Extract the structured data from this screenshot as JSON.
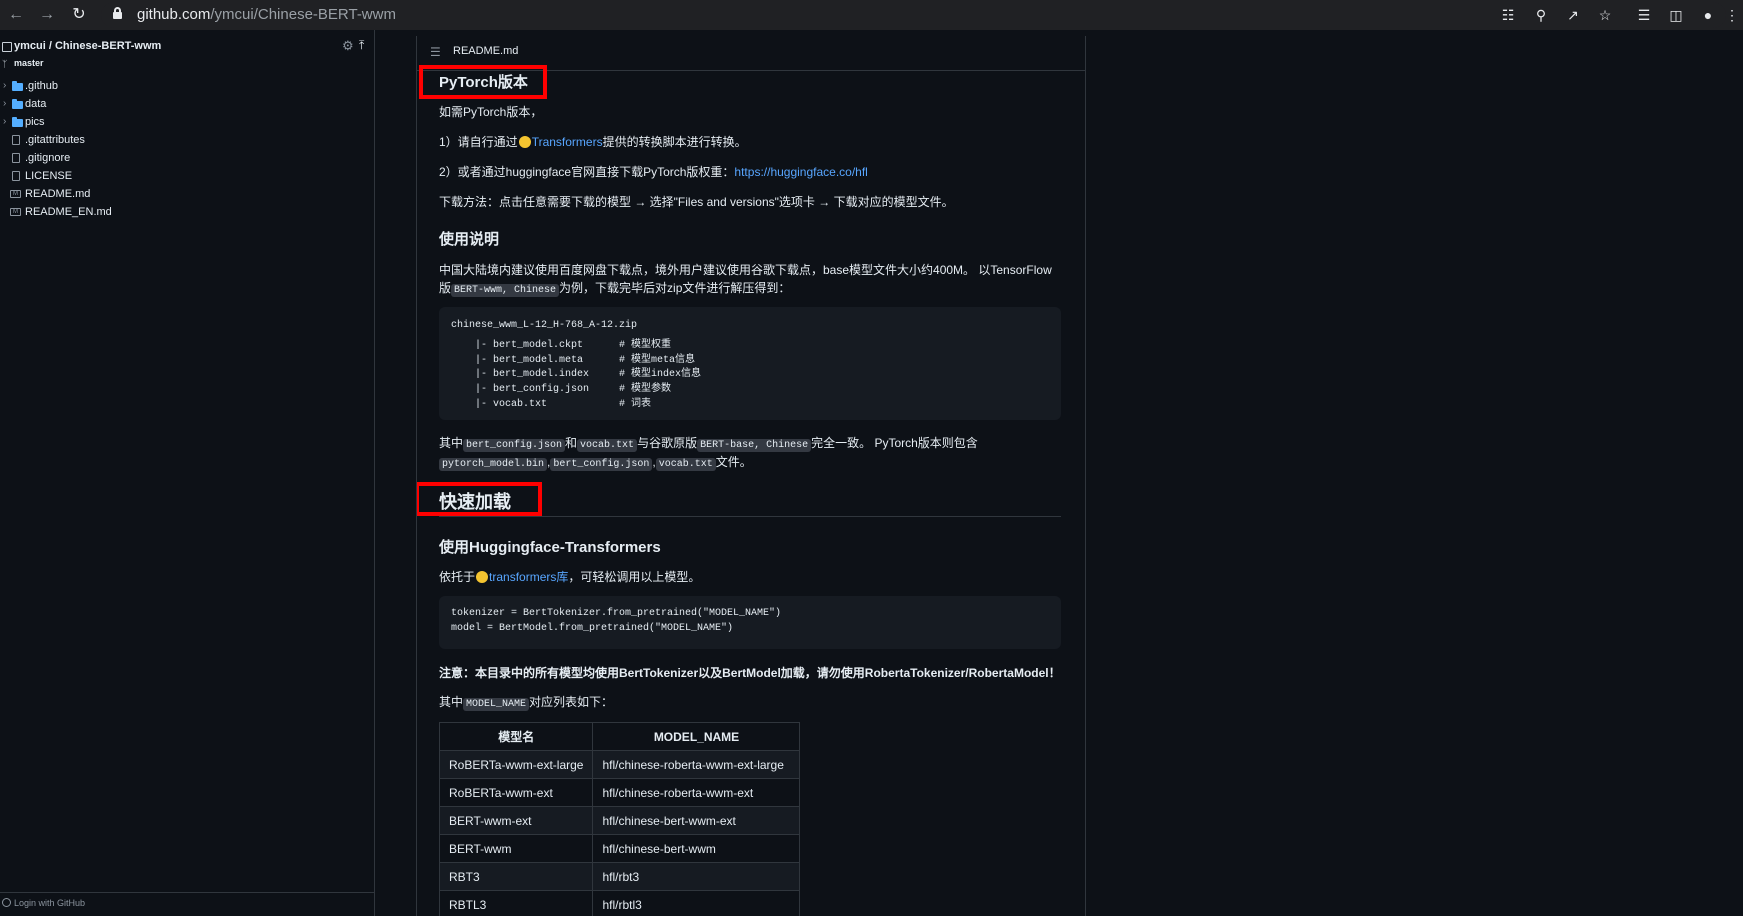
{
  "browser": {
    "url_host": "github.com",
    "url_path": "/ymcui/Chinese-BERT-wwm"
  },
  "sidebar": {
    "repo": "ymcui / Chinese-BERT-wwm",
    "branch": "master",
    "items": [
      {
        "label": ".github",
        "type": "folder"
      },
      {
        "label": "data",
        "type": "folder"
      },
      {
        "label": "pics",
        "type": "folder"
      },
      {
        "label": ".gitattributes",
        "type": "file"
      },
      {
        "label": ".gitignore",
        "type": "file"
      },
      {
        "label": "LICENSE",
        "type": "file"
      },
      {
        "label": "README.md",
        "type": "md"
      },
      {
        "label": "README_EN.md",
        "type": "md"
      }
    ],
    "login": "Login with GitHub"
  },
  "readme": {
    "title": "README.md",
    "h_pytorch": "PyTorch版本",
    "p1": "如需PyTorch版本，",
    "p2_prefix": "1）请自行通过",
    "p2_link": "Transformers",
    "p2_suffix": "提供的转换脚本进行转换。",
    "p3_prefix": "2）或者通过huggingface官网直接下载PyTorch版权重：",
    "p3_link": "https://huggingface.co/hfl",
    "p4": "下载方法：点击任意需要下载的模型 → 选择\"Files and versions\"选项卡 → 下载对应的模型文件。",
    "h_usage": "使用说明",
    "p5_line1": "中国大陆境内建议使用百度网盘下载点，境外用户建议使用谷歌下载点，base模型文件大小约400M。 以TensorFlow",
    "p5_prefix": "版",
    "p5_code": "BERT-wwm, Chinese",
    "p5_suffix": "为例，下载完毕后对zip文件进行解压得到：",
    "code1": [
      "chinese_wwm_L-12_H-768_A-12.zip",
      "    |- bert_model.ckpt      # 模型权重",
      "    |- bert_model.meta      # 模型meta信息",
      "    |- bert_model.index     # 模型index信息",
      "    |- bert_config.json     # 模型参数",
      "    |- vocab.txt            # 词表"
    ],
    "p6_a": "其中",
    "p6_code1": "bert_config.json",
    "p6_b": "和",
    "p6_code2": "vocab.txt",
    "p6_c": "与谷歌原版",
    "p6_code3": "BERT-base, Chinese",
    "p6_d": "完全一致。 PyTorch版本则包含",
    "p6_code4": "pytorch_model.bin",
    "p6_sep1": ",",
    "p6_code5": "bert_config.json",
    "p6_sep2": ",",
    "p6_code6": "vocab.txt",
    "p6_e": "文件。",
    "h_quick": "快速加载",
    "h_hf": "使用Huggingface-Transformers",
    "p7_prefix": "依托于",
    "p7_link": "transformers库",
    "p7_suffix": "，可轻松调用以上模型。",
    "code2": [
      "tokenizer = BertTokenizer.from_pretrained(\"MODEL_NAME\")",
      "model = BertModel.from_pretrained(\"MODEL_NAME\")"
    ],
    "note": "注意：本目录中的所有模型均使用BertTokenizer以及BertModel加载，请勿使用RobertaTokenizer/RobertaModel！",
    "p8_prefix": "其中",
    "p8_code": "MODEL_NAME",
    "p8_suffix": "对应列表如下：",
    "table": {
      "headers": [
        "模型名",
        "MODEL_NAME"
      ],
      "rows": [
        [
          "RoBERTa-wwm-ext-large",
          "hfl/chinese-roberta-wwm-ext-large"
        ],
        [
          "RoBERTa-wwm-ext",
          "hfl/chinese-roberta-wwm-ext"
        ],
        [
          "BERT-wwm-ext",
          "hfl/chinese-bert-wwm-ext"
        ],
        [
          "BERT-wwm",
          "hfl/chinese-bert-wwm"
        ],
        [
          "RBT3",
          "hfl/rbt3"
        ],
        [
          "RBTL3",
          "hfl/rbtl3"
        ]
      ]
    }
  }
}
